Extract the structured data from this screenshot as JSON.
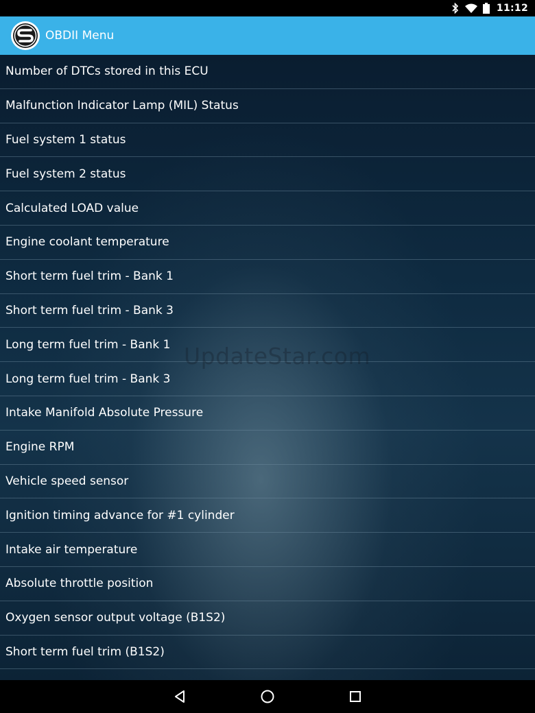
{
  "status_bar": {
    "time": "11:12",
    "icons": [
      "bluetooth-icon",
      "wifi-icon",
      "battery-icon"
    ]
  },
  "app_bar": {
    "title": "OBDII Menu",
    "logo_icon": "s-logo-icon",
    "color": "#3ab2e8"
  },
  "menu": {
    "items": [
      "Number of DTCs stored in this ECU",
      "Malfunction Indicator Lamp (MIL) Status",
      "Fuel system 1 status",
      "Fuel system 2 status",
      "Calculated LOAD value",
      "Engine coolant temperature",
      "Short term fuel trim - Bank 1",
      "Short term fuel trim - Bank 3",
      "Long term fuel trim - Bank 1",
      "Long term fuel trim - Bank 3",
      "Intake Manifold Absolute Pressure",
      "Engine RPM",
      "Vehicle speed sensor",
      "Ignition timing advance for #1 cylinder",
      "Intake air temperature",
      "Absolute throttle position",
      "Oxygen sensor output voltage (B1S2)",
      "Short term fuel trim (B1S2)"
    ]
  },
  "watermark": "UpdateStar.com",
  "nav_bar": {
    "buttons": [
      "back-icon",
      "home-icon",
      "recents-icon"
    ]
  }
}
